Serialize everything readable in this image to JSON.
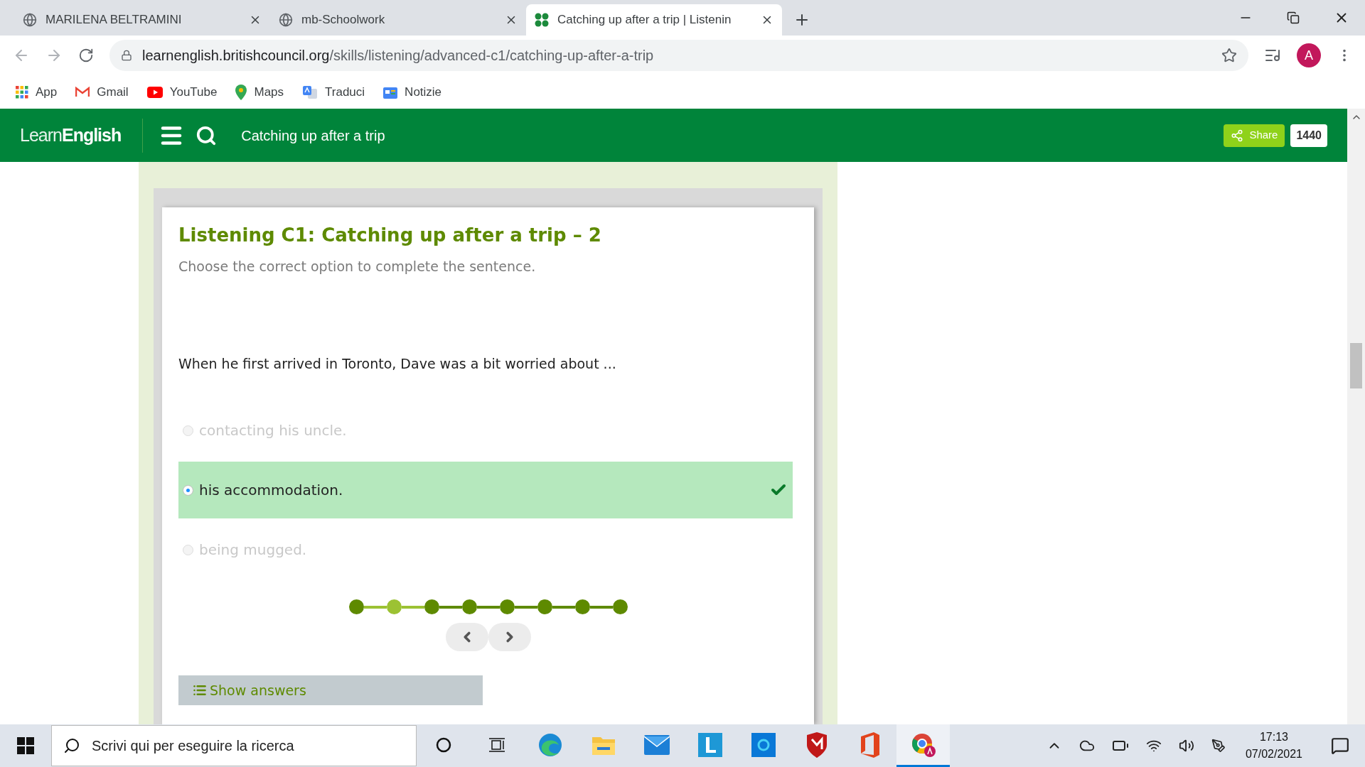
{
  "browser": {
    "tabs": [
      {
        "title": "MARILENA BELTRAMINI",
        "kind": "globe",
        "selected": false
      },
      {
        "title": "mb-Schoolwork",
        "kind": "globe",
        "selected": false
      },
      {
        "title": "Catching up after a trip | Listenin",
        "kind": "clover",
        "selected": true
      }
    ],
    "url_host": "learnenglish.britishcouncil.org",
    "url_path": "/skills/listening/advanced-c1/catching-up-after-a-trip",
    "profile_initial": "A",
    "bookmarks": [
      {
        "label": "App",
        "kind": "apps"
      },
      {
        "label": "Gmail",
        "kind": "gmail"
      },
      {
        "label": "YouTube",
        "kind": "youtube"
      },
      {
        "label": "Maps",
        "kind": "maps"
      },
      {
        "label": "Traduci",
        "kind": "translate"
      },
      {
        "label": "Notizie",
        "kind": "news"
      }
    ]
  },
  "site_header": {
    "logo_light": "Learn",
    "logo_bold": "English",
    "page_title": "Catching up after a trip",
    "share_label": "Share",
    "share_count": "1440"
  },
  "exercise": {
    "title": "Listening C1: Catching up after a trip – 2",
    "instruction": "Choose the correct option to complete the sentence.",
    "question": "When he first arrived in Toronto, Dave was a bit worried about ...",
    "options": [
      {
        "label": "contacting his uncle.",
        "selected": false
      },
      {
        "label": "his accommodation.",
        "selected": true
      },
      {
        "label": "being mugged.",
        "selected": false
      }
    ],
    "steps": [
      {
        "selected": false
      },
      {
        "selected": true
      },
      {
        "selected": false
      },
      {
        "selected": false
      },
      {
        "selected": false
      },
      {
        "selected": false
      },
      {
        "selected": false
      },
      {
        "selected": false
      }
    ],
    "show_answers_label": "Show answers"
  },
  "taskbar": {
    "search_placeholder": "Scrivi qui per eseguire la ricerca",
    "apps": [
      {
        "kind": "cortana",
        "active": false
      },
      {
        "kind": "taskview",
        "active": false
      },
      {
        "kind": "edge",
        "active": false
      },
      {
        "kind": "explorer",
        "active": false
      },
      {
        "kind": "mail",
        "active": false
      },
      {
        "kind": "letter-app",
        "active": false
      },
      {
        "kind": "blue-app",
        "active": false
      },
      {
        "kind": "shield",
        "active": false
      },
      {
        "kind": "office",
        "active": false
      },
      {
        "kind": "chrome",
        "active": true
      }
    ],
    "time": "17:13",
    "date": "07/02/2021"
  }
}
